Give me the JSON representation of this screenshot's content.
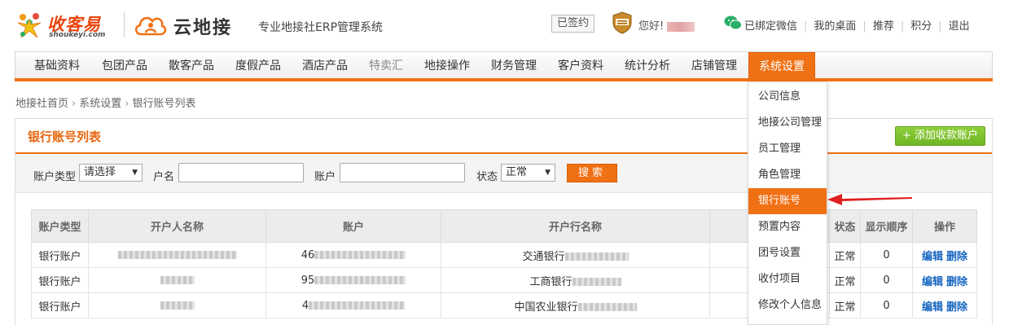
{
  "header": {
    "logo1_text": "收客易",
    "logo1_sub": "shoukeyi.com",
    "logo2_text": "云地接",
    "tagline": "专业地接社ERP管理系统",
    "signed_label": "已签约",
    "greeting": "您好!",
    "wechat_label": "已绑定微信",
    "links": [
      "我的桌面",
      "推荐",
      "积分",
      "退出"
    ]
  },
  "nav": {
    "items": [
      "基础资料",
      "包团产品",
      "散客产品",
      "度假产品",
      "酒店产品",
      "特卖汇",
      "地接操作",
      "财务管理",
      "客户资料",
      "统计分析",
      "店铺管理",
      "系统设置"
    ],
    "active": "系统设置"
  },
  "breadcrumb": [
    "地接社首页",
    "系统设置",
    "银行账号列表"
  ],
  "panel": {
    "title": "银行账号列表",
    "add_button": "+ 添加收款账户"
  },
  "filters": {
    "account_type_label": "账户类型",
    "account_type_value": "请选择",
    "name_label": "户名",
    "account_label": "账户",
    "status_label": "状态",
    "status_value": "正常",
    "search_button": "搜索"
  },
  "table": {
    "headers": [
      "账户类型",
      "开户人名称",
      "账户",
      "开户行名称",
      "",
      "状态",
      "显示顺序",
      "操作"
    ],
    "rows": [
      {
        "type": "银行账户",
        "account_prefix": "46",
        "bank": "交通银行",
        "status": "正常",
        "order": "0"
      },
      {
        "type": "银行账户",
        "account_prefix": "95",
        "bank": "工商银行",
        "status": "正常",
        "order": "0"
      },
      {
        "type": "银行账户",
        "account_prefix": "4",
        "bank": "中国农业银行",
        "status": "正常",
        "order": "0"
      }
    ],
    "edit_label": "编辑",
    "delete_label": "删除"
  },
  "dropdown": {
    "items": [
      "公司信息",
      "地接公司管理",
      "员工管理",
      "角色管理",
      "银行账号",
      "预置内容",
      "团号设置",
      "收付项目",
      "修改个人信息"
    ],
    "active": "银行账号"
  },
  "colors": {
    "accent": "#f07014",
    "link": "#1565c0",
    "add_button": "#6fb526"
  }
}
